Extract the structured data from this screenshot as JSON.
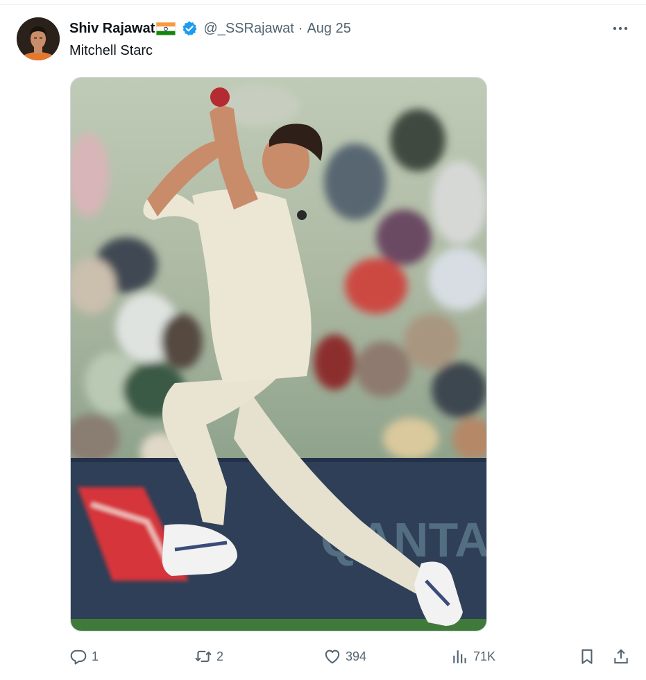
{
  "tweet": {
    "display_name": "Shiv Rajawat",
    "handle": "@_SSRajawat",
    "separator": "·",
    "date": "Aug 25",
    "text": "Mitchell Starc",
    "flag_icon": "india-flag-icon",
    "verified_icon": "verified-badge-icon",
    "accent_color": "#1d9bf0"
  },
  "stats": {
    "replies": "1",
    "reposts": "2",
    "likes": "394",
    "views": "71K"
  },
  "media": {
    "banner_text": "QANTAS"
  },
  "icons": {
    "more": "more-options-icon",
    "reply": "reply-icon",
    "repost": "repost-icon",
    "like": "like-icon",
    "views": "views-icon",
    "bookmark": "bookmark-icon",
    "share": "share-icon"
  }
}
